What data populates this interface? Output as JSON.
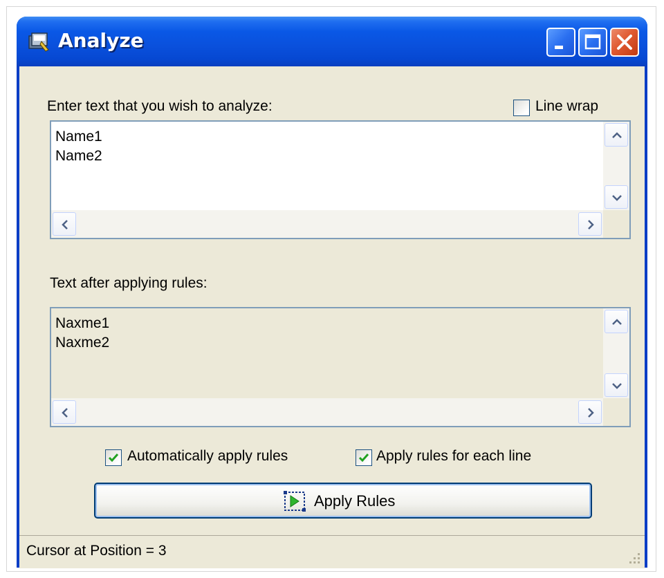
{
  "window": {
    "title": "Analyze",
    "controls": [
      "minimize",
      "maximize",
      "close"
    ]
  },
  "input_section": {
    "label": "Enter text that you wish to analyze:",
    "line_wrap_label": "Line wrap",
    "line_wrap_checked": false,
    "lines": [
      "Name1",
      "Name2"
    ]
  },
  "output_section": {
    "label": "Text after applying rules:",
    "lines": [
      "Naxme1",
      "Naxme2"
    ]
  },
  "options": {
    "auto_apply_label": "Automatically apply rules",
    "auto_apply_checked": true,
    "each_line_label": "Apply rules for each line",
    "each_line_checked": true
  },
  "apply_button": {
    "label": "Apply Rules",
    "icon": "play-rules-icon"
  },
  "status": {
    "text": "Cursor at Position = 3"
  },
  "colors": {
    "title_bar": "#0a58e6",
    "client_bg": "#ece9d8",
    "textbox_border": "#7f9db9",
    "check_mark": "#21a121",
    "close_button": "#e05a32"
  }
}
